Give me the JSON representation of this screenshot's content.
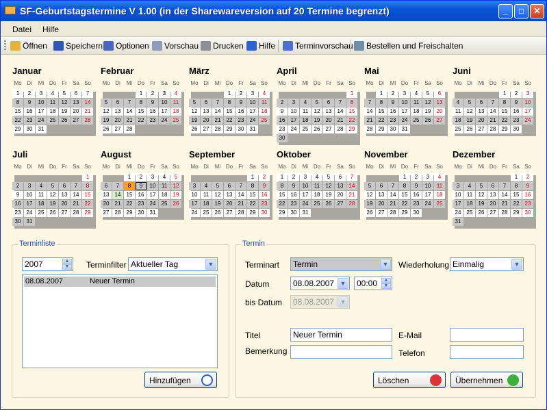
{
  "title": "SF-Geburtstagstermine  V 1.00 (in der Sharewareversion auf 20 Termine begrenzt)",
  "window_buttons": {
    "minimize": "_",
    "maximize": "□",
    "close": "✕"
  },
  "menu": [
    "Datei",
    "Hilfe"
  ],
  "toolbar": [
    {
      "label": "Öffnen",
      "icon": "folder-open-icon",
      "color": "#e7b13c"
    },
    {
      "label": "Speichern",
      "icon": "floppy-disk-icon",
      "color": "#2f55b5"
    },
    {
      "label": "Optionen",
      "icon": "gear-icon",
      "color": "#4a64c2"
    },
    {
      "label": "Vorschau",
      "icon": "magnifier-page-icon",
      "color": "#8e9cb9"
    },
    {
      "label": "Drucken",
      "icon": "printer-icon",
      "color": "#8c8f96"
    },
    {
      "label": "Hilfe",
      "icon": "help-icon",
      "color": "#2d62d0"
    },
    {
      "label": "Terminvorschau",
      "icon": "clock-icon",
      "color": "#4f6fd0"
    },
    {
      "label": "Bestellen und Freischalten",
      "icon": "cart-icon",
      "color": "#6f8fa8"
    }
  ],
  "weekdays": [
    "Mo",
    "Di",
    "Mi",
    "Do",
    "Fr",
    "Sa",
    "So"
  ],
  "months": [
    {
      "name": "Januar",
      "offset": 0,
      "days": 31
    },
    {
      "name": "Februar",
      "offset": 3,
      "days": 28
    },
    {
      "name": "März",
      "offset": 3,
      "days": 31
    },
    {
      "name": "April",
      "offset": 6,
      "days": 30
    },
    {
      "name": "Mai",
      "offset": 1,
      "days": 31
    },
    {
      "name": "Juni",
      "offset": 4,
      "days": 30
    },
    {
      "name": "Juli",
      "offset": 6,
      "days": 31
    },
    {
      "name": "August",
      "offset": 2,
      "days": 31
    },
    {
      "name": "September",
      "offset": 5,
      "days": 30
    },
    {
      "name": "Oktober",
      "offset": 0,
      "days": 31
    },
    {
      "name": "November",
      "offset": 3,
      "days": 30
    },
    {
      "name": "Dezember",
      "offset": 5,
      "days": 31
    }
  ],
  "calendar_marks": {
    "today_month": 7,
    "today_day": 8,
    "selected_day": 9,
    "green_day": 14
  },
  "terminliste": {
    "group_label": "Terminliste",
    "year": "2007",
    "filter_label": "Terminfilter",
    "filter_value": "Aktueller Tag",
    "items": [
      {
        "date": "08.08.2007",
        "title": "Neuer Termin"
      }
    ],
    "add_button": "Hinzufügen"
  },
  "termin": {
    "group_label": "Termin",
    "terminart_label": "Terminart",
    "terminart_value": "Termin",
    "wiederholung_label": "Wiederholung",
    "wiederholung_value": "Einmalig",
    "datum_label": "Datum",
    "datum_value": "08.08.2007",
    "zeit_value": "00:00",
    "bisdatum_label": "bis Datum",
    "bisdatum_value": "08.08.2007",
    "titel_label": "Titel",
    "titel_value": "Neuer Termin",
    "bemerkung_label": "Bemerkung",
    "bemerkung_value": "",
    "email_label": "E-Mail",
    "email_value": "",
    "telefon_label": "Telefon",
    "telefon_value": "",
    "delete_button": "Löschen",
    "apply_button": "Übernehmen"
  }
}
